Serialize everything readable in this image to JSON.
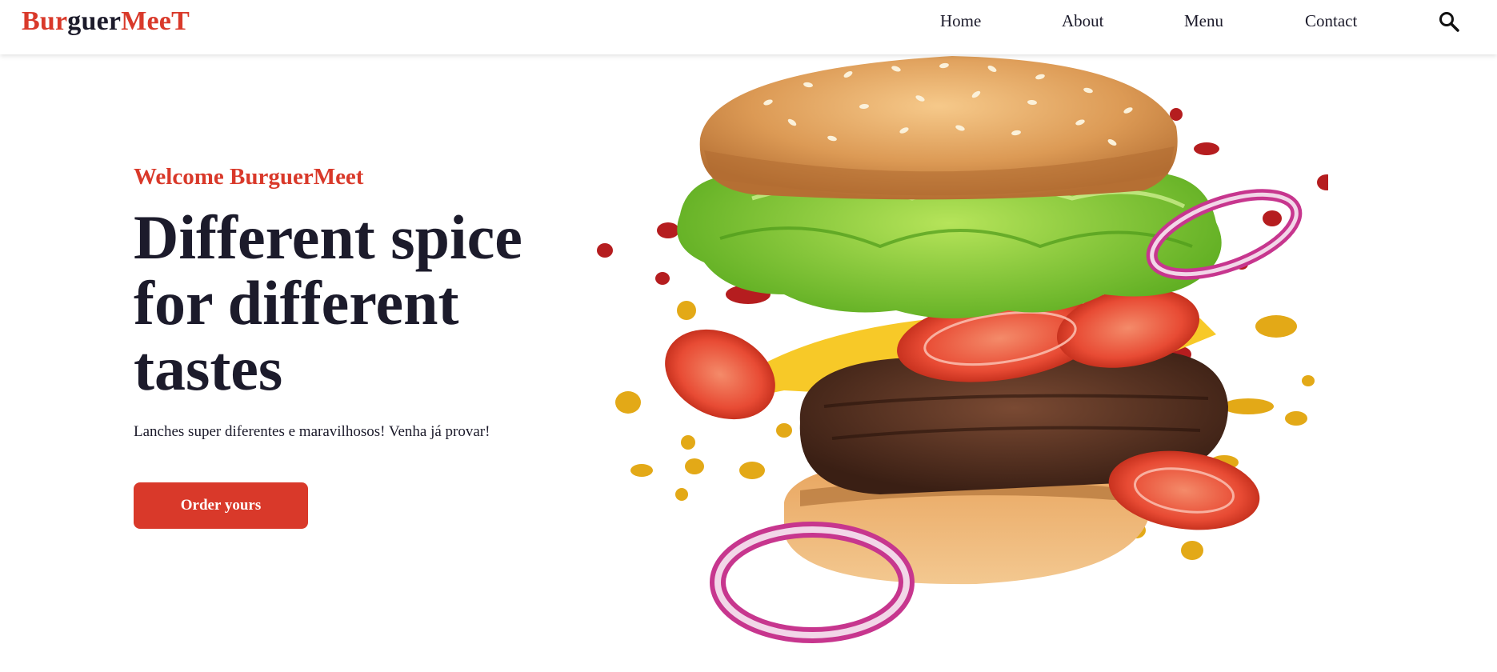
{
  "brand": {
    "logo_parts": [
      {
        "text": "Bur",
        "tone": "red"
      },
      {
        "text": "guer",
        "tone": "dark"
      },
      {
        "text": "Mee",
        "tone": "red"
      },
      {
        "text": "T",
        "tone": "red"
      }
    ]
  },
  "nav": {
    "items": [
      "Home",
      "About",
      "Menu",
      "Contact"
    ],
    "search_icon": "search-icon"
  },
  "hero": {
    "welcome": "Welcome BurguerMeet",
    "headline_lines": [
      "Different spice",
      "for different",
      "tastes"
    ],
    "subtext": "Lanches super diferentes e maravilhosos! Venha já provar!",
    "cta_label": "Order yours",
    "image_subject": "burger-illustration"
  },
  "colors": {
    "accent": "#d9392a",
    "text_dark": "#1c1b2b",
    "background": "#ffffff"
  }
}
